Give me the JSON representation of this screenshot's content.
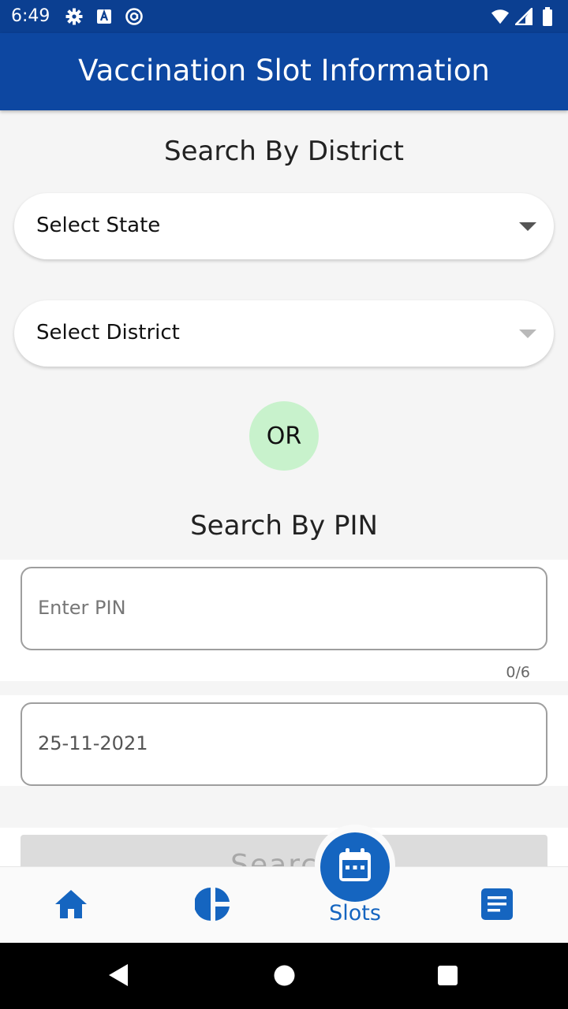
{
  "status_bar": {
    "time": "6:49",
    "left_icons": [
      "gear-icon",
      "a-box-icon",
      "at-sign-icon"
    ],
    "right_icons": [
      "wifi-icon",
      "signal-icon",
      "battery-icon"
    ]
  },
  "app_bar": {
    "title": "Vaccination Slot Information"
  },
  "district_search": {
    "title": "Search By District",
    "state_select": {
      "value": "Select State",
      "enabled": true
    },
    "district_select": {
      "value": "Select District",
      "enabled": false
    }
  },
  "or_label": "OR",
  "pin_search": {
    "title": "Search By PIN",
    "pin_field": {
      "placeholder": "Enter PIN",
      "value": "",
      "counter": "0/6"
    },
    "date_field": {
      "value": "25-11-2021"
    },
    "search_button": {
      "label": "Search"
    }
  },
  "bottom_nav": {
    "items": [
      {
        "icon": "home-icon",
        "label": ""
      },
      {
        "icon": "pie-chart-icon",
        "label": ""
      },
      {
        "icon": "calendar-icon",
        "label": "Slots",
        "active": true
      },
      {
        "icon": "notes-icon",
        "label": ""
      }
    ]
  },
  "colors": {
    "primary": "#0d47a1",
    "status_bar": "#0b3f91",
    "accent_blue": "#1565c0",
    "or_badge": "#c8f2cc",
    "background": "#f5f5f5"
  }
}
